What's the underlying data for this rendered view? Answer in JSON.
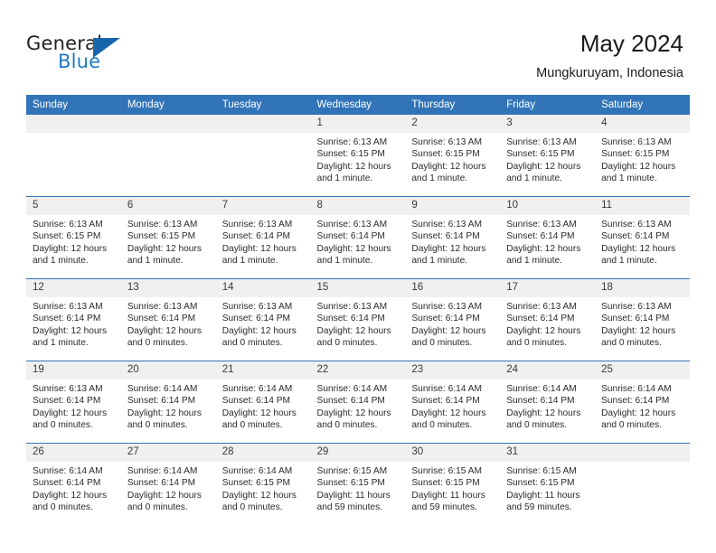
{
  "brand": {
    "name_part1": "General",
    "name_part2": "Blue",
    "logo_icon": "blue-triangle-logo"
  },
  "header": {
    "title": "May 2024",
    "subtitle": "Mungkuruyam, Indonesia"
  },
  "calendar": {
    "accent_color": "#3274b8",
    "daynum_bg": "#f0f0f0",
    "weekday_headers": [
      "Sunday",
      "Monday",
      "Tuesday",
      "Wednesday",
      "Thursday",
      "Friday",
      "Saturday"
    ],
    "weeks": [
      [
        {
          "day": "",
          "sunrise": "",
          "sunset": "",
          "daylight": ""
        },
        {
          "day": "",
          "sunrise": "",
          "sunset": "",
          "daylight": ""
        },
        {
          "day": "",
          "sunrise": "",
          "sunset": "",
          "daylight": ""
        },
        {
          "day": "1",
          "sunrise": "Sunrise: 6:13 AM",
          "sunset": "Sunset: 6:15 PM",
          "daylight": "Daylight: 12 hours and 1 minute."
        },
        {
          "day": "2",
          "sunrise": "Sunrise: 6:13 AM",
          "sunset": "Sunset: 6:15 PM",
          "daylight": "Daylight: 12 hours and 1 minute."
        },
        {
          "day": "3",
          "sunrise": "Sunrise: 6:13 AM",
          "sunset": "Sunset: 6:15 PM",
          "daylight": "Daylight: 12 hours and 1 minute."
        },
        {
          "day": "4",
          "sunrise": "Sunrise: 6:13 AM",
          "sunset": "Sunset: 6:15 PM",
          "daylight": "Daylight: 12 hours and 1 minute."
        }
      ],
      [
        {
          "day": "5",
          "sunrise": "Sunrise: 6:13 AM",
          "sunset": "Sunset: 6:15 PM",
          "daylight": "Daylight: 12 hours and 1 minute."
        },
        {
          "day": "6",
          "sunrise": "Sunrise: 6:13 AM",
          "sunset": "Sunset: 6:15 PM",
          "daylight": "Daylight: 12 hours and 1 minute."
        },
        {
          "day": "7",
          "sunrise": "Sunrise: 6:13 AM",
          "sunset": "Sunset: 6:14 PM",
          "daylight": "Daylight: 12 hours and 1 minute."
        },
        {
          "day": "8",
          "sunrise": "Sunrise: 6:13 AM",
          "sunset": "Sunset: 6:14 PM",
          "daylight": "Daylight: 12 hours and 1 minute."
        },
        {
          "day": "9",
          "sunrise": "Sunrise: 6:13 AM",
          "sunset": "Sunset: 6:14 PM",
          "daylight": "Daylight: 12 hours and 1 minute."
        },
        {
          "day": "10",
          "sunrise": "Sunrise: 6:13 AM",
          "sunset": "Sunset: 6:14 PM",
          "daylight": "Daylight: 12 hours and 1 minute."
        },
        {
          "day": "11",
          "sunrise": "Sunrise: 6:13 AM",
          "sunset": "Sunset: 6:14 PM",
          "daylight": "Daylight: 12 hours and 1 minute."
        }
      ],
      [
        {
          "day": "12",
          "sunrise": "Sunrise: 6:13 AM",
          "sunset": "Sunset: 6:14 PM",
          "daylight": "Daylight: 12 hours and 1 minute."
        },
        {
          "day": "13",
          "sunrise": "Sunrise: 6:13 AM",
          "sunset": "Sunset: 6:14 PM",
          "daylight": "Daylight: 12 hours and 0 minutes."
        },
        {
          "day": "14",
          "sunrise": "Sunrise: 6:13 AM",
          "sunset": "Sunset: 6:14 PM",
          "daylight": "Daylight: 12 hours and 0 minutes."
        },
        {
          "day": "15",
          "sunrise": "Sunrise: 6:13 AM",
          "sunset": "Sunset: 6:14 PM",
          "daylight": "Daylight: 12 hours and 0 minutes."
        },
        {
          "day": "16",
          "sunrise": "Sunrise: 6:13 AM",
          "sunset": "Sunset: 6:14 PM",
          "daylight": "Daylight: 12 hours and 0 minutes."
        },
        {
          "day": "17",
          "sunrise": "Sunrise: 6:13 AM",
          "sunset": "Sunset: 6:14 PM",
          "daylight": "Daylight: 12 hours and 0 minutes."
        },
        {
          "day": "18",
          "sunrise": "Sunrise: 6:13 AM",
          "sunset": "Sunset: 6:14 PM",
          "daylight": "Daylight: 12 hours and 0 minutes."
        }
      ],
      [
        {
          "day": "19",
          "sunrise": "Sunrise: 6:13 AM",
          "sunset": "Sunset: 6:14 PM",
          "daylight": "Daylight: 12 hours and 0 minutes."
        },
        {
          "day": "20",
          "sunrise": "Sunrise: 6:14 AM",
          "sunset": "Sunset: 6:14 PM",
          "daylight": "Daylight: 12 hours and 0 minutes."
        },
        {
          "day": "21",
          "sunrise": "Sunrise: 6:14 AM",
          "sunset": "Sunset: 6:14 PM",
          "daylight": "Daylight: 12 hours and 0 minutes."
        },
        {
          "day": "22",
          "sunrise": "Sunrise: 6:14 AM",
          "sunset": "Sunset: 6:14 PM",
          "daylight": "Daylight: 12 hours and 0 minutes."
        },
        {
          "day": "23",
          "sunrise": "Sunrise: 6:14 AM",
          "sunset": "Sunset: 6:14 PM",
          "daylight": "Daylight: 12 hours and 0 minutes."
        },
        {
          "day": "24",
          "sunrise": "Sunrise: 6:14 AM",
          "sunset": "Sunset: 6:14 PM",
          "daylight": "Daylight: 12 hours and 0 minutes."
        },
        {
          "day": "25",
          "sunrise": "Sunrise: 6:14 AM",
          "sunset": "Sunset: 6:14 PM",
          "daylight": "Daylight: 12 hours and 0 minutes."
        }
      ],
      [
        {
          "day": "26",
          "sunrise": "Sunrise: 6:14 AM",
          "sunset": "Sunset: 6:14 PM",
          "daylight": "Daylight: 12 hours and 0 minutes."
        },
        {
          "day": "27",
          "sunrise": "Sunrise: 6:14 AM",
          "sunset": "Sunset: 6:14 PM",
          "daylight": "Daylight: 12 hours and 0 minutes."
        },
        {
          "day": "28",
          "sunrise": "Sunrise: 6:14 AM",
          "sunset": "Sunset: 6:15 PM",
          "daylight": "Daylight: 12 hours and 0 minutes."
        },
        {
          "day": "29",
          "sunrise": "Sunrise: 6:15 AM",
          "sunset": "Sunset: 6:15 PM",
          "daylight": "Daylight: 11 hours and 59 minutes."
        },
        {
          "day": "30",
          "sunrise": "Sunrise: 6:15 AM",
          "sunset": "Sunset: 6:15 PM",
          "daylight": "Daylight: 11 hours and 59 minutes."
        },
        {
          "day": "31",
          "sunrise": "Sunrise: 6:15 AM",
          "sunset": "Sunset: 6:15 PM",
          "daylight": "Daylight: 11 hours and 59 minutes."
        },
        {
          "day": "",
          "sunrise": "",
          "sunset": "",
          "daylight": ""
        }
      ]
    ]
  }
}
